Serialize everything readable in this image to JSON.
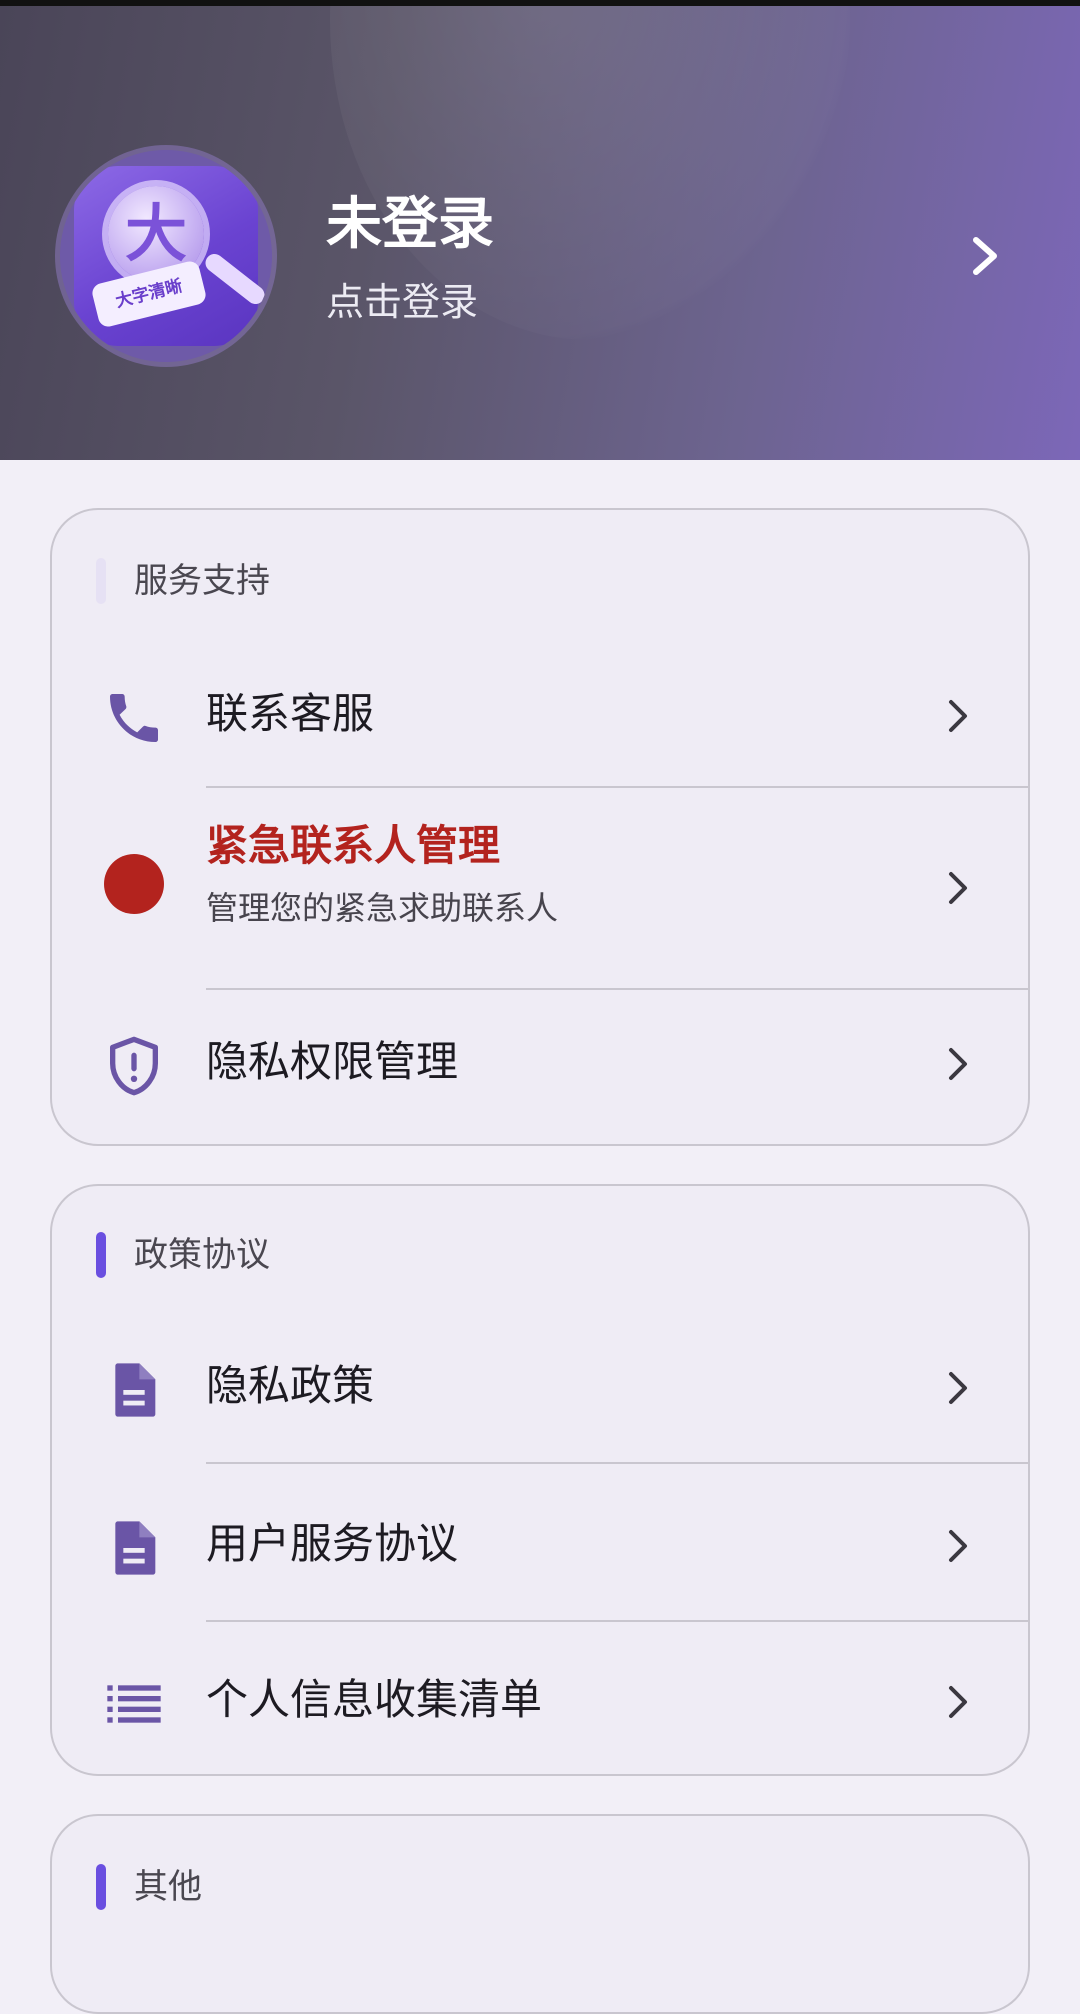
{
  "header": {
    "title": "未登录",
    "subtitle": "点击登录",
    "avatar": {
      "glyph": "大",
      "card_text": "大字清晰"
    },
    "chevron_icon": "chevron-right-icon"
  },
  "sections": [
    {
      "title": "服务支持",
      "bar_color": "#e6e1f4",
      "items": [
        {
          "label": "联系客服",
          "icon": "phone-icon"
        },
        {
          "label": "紧急联系人管理",
          "sublabel": "管理您的紧急求助联系人",
          "icon": "red-dot-icon"
        },
        {
          "label": "隐私权限管理",
          "icon": "shield-icon"
        }
      ]
    },
    {
      "title": "政策协议",
      "bar_color": "#6a4fe0",
      "items": [
        {
          "label": "隐私政策",
          "icon": "document-icon"
        },
        {
          "label": "用户服务协议",
          "icon": "document-icon"
        },
        {
          "label": "个人信息收集清单",
          "icon": "list-icon"
        }
      ]
    },
    {
      "title": "其他",
      "bar_color": "#6a4fe0",
      "items": []
    }
  ],
  "colors": {
    "accent": "#6a4fe0",
    "icon": "#6a55a6",
    "emergency": "#b3231e",
    "background": "#f2eff7",
    "card": "#efecf5"
  }
}
